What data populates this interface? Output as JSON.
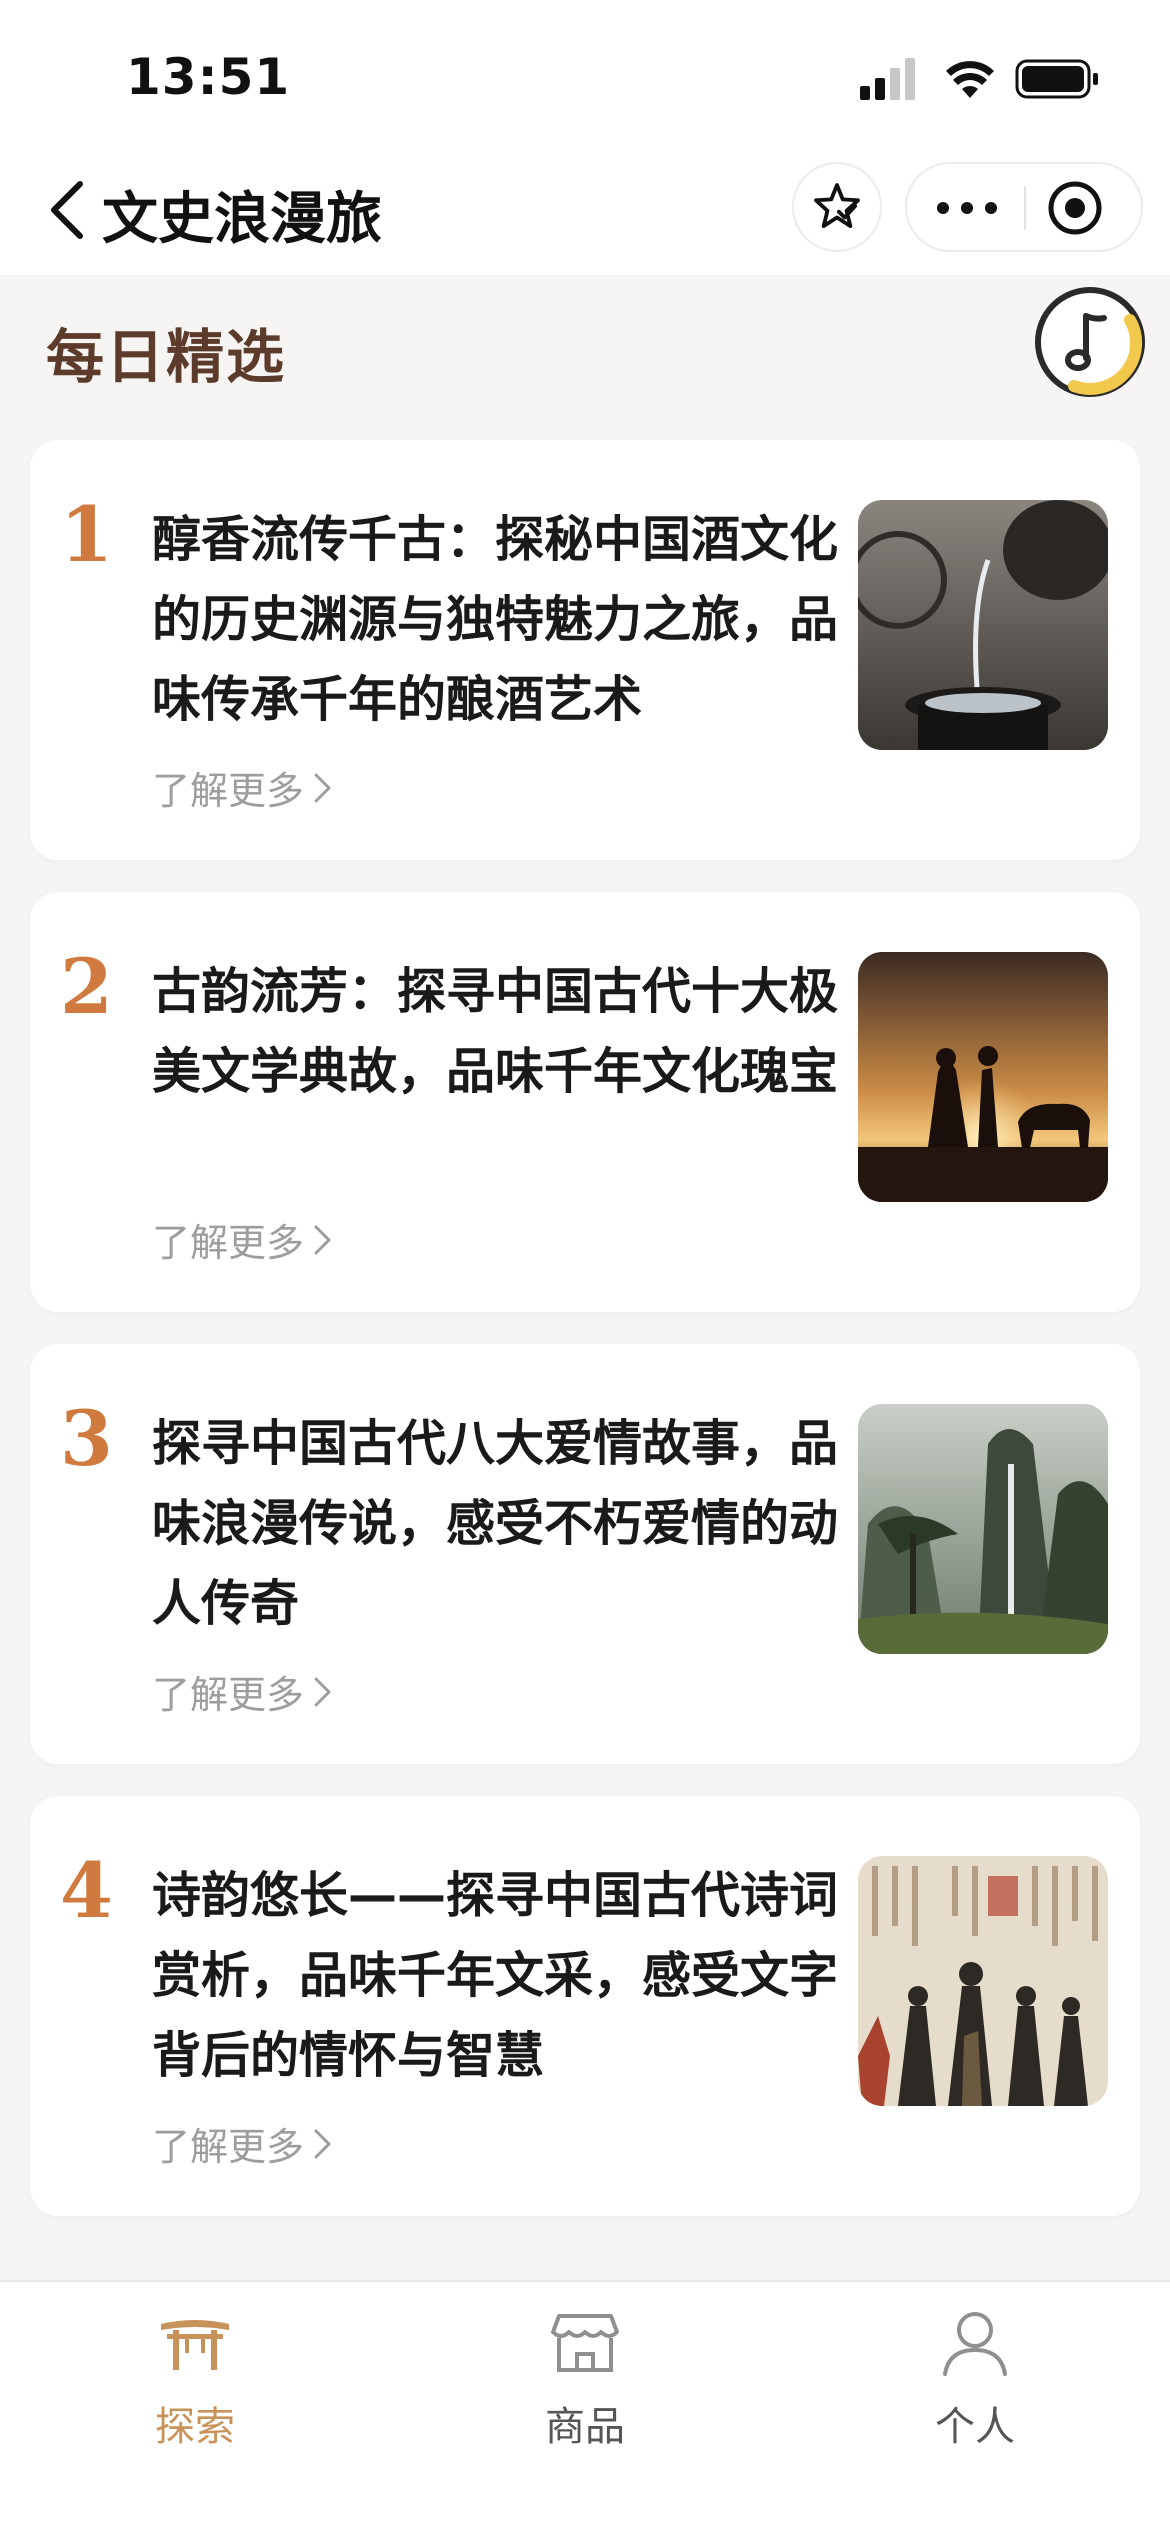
{
  "status_bar": {
    "time": "13:51"
  },
  "nav": {
    "title": "文史浪漫旅"
  },
  "section": {
    "title": "每日精选"
  },
  "articles": [
    {
      "rank": "1",
      "title": "醇香流传千古：探秘中国酒文化的历史渊源与独特魅力之旅，品味传承千年的酿酒艺术",
      "more_label": "了解更多",
      "thumbnail": "wine-pouring-image"
    },
    {
      "rank": "2",
      "title": "古韵流芳：探寻中国古代十大极美文学典故，品味千年文化瑰宝",
      "more_label": "了解更多",
      "thumbnail": "sunset-couple-image"
    },
    {
      "rank": "3",
      "title": "探寻中国古代八大爱情故事，品味浪漫传说，感受不朽爱情的动人传奇",
      "more_label": "了解更多",
      "thumbnail": "ink-landscape-image"
    },
    {
      "rank": "4",
      "title": "诗韵悠长——探寻中国古代诗词赏析，品味千年文采，感受文字背后的情怀与智慧",
      "more_label": "了解更多",
      "thumbnail": "ancient-scholars-image"
    }
  ],
  "tabs": [
    {
      "label": "探索",
      "icon": "gate-icon",
      "active": true
    },
    {
      "label": "商品",
      "icon": "store-icon",
      "active": false
    },
    {
      "label": "个人",
      "icon": "person-icon",
      "active": false
    }
  ],
  "colors": {
    "accent": "#c8935a",
    "rank": "#d07a3f",
    "section_title": "#5c3b2a",
    "inactive_tab": "#555555"
  }
}
